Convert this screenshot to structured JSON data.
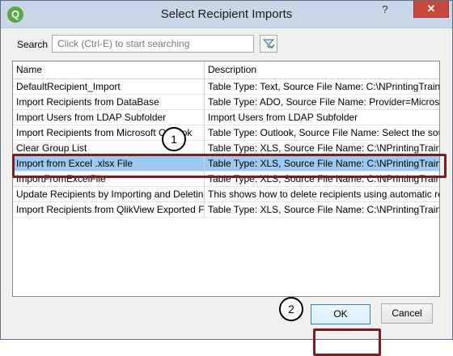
{
  "window": {
    "title": "Select Recipient Imports",
    "help_label": "?",
    "close_label": "✕"
  },
  "search": {
    "label": "Search",
    "placeholder": "Click (Ctrl-E) to start searching"
  },
  "grid": {
    "columns": [
      "Name",
      "Description"
    ],
    "rows": [
      {
        "name": "DefaultRecipient_Import",
        "description": "Table Type: Text, Source File Name: C:\\NPrintingTraini"
      },
      {
        "name": "Import Recipients from DataBase",
        "description": "Table Type: ADO, Source File Name: Provider=Microsc"
      },
      {
        "name": "Import Users from LDAP Subfolder",
        "description": "Import Users from LDAP Subfolder"
      },
      {
        "name": "Import Recipients from Microsoft Outlook",
        "description": "Table Type: Outlook, Source File Name: Select the sour"
      },
      {
        "name": "Clear Group List",
        "description": "Table Type: XLS, Source File Name: C:\\NPrintingTraini"
      },
      {
        "name": "Import from Excel .xlsx File",
        "description": "Table Type: XLS, Source File Name: C:\\NPrintingTraini"
      },
      {
        "name": "ImportFromExcelFile",
        "description": "Table Type: XLS, Source File Name: C:\\NPrintingTraini"
      },
      {
        "name": "Update Recipients by Importing and Deleting",
        "description": "This shows how to delete recipients using automatic re"
      },
      {
        "name": "Import Recipients from QlikView Exported Fi",
        "description": "Table Type: XLS, Source File Name: C:\\NPrintingTraini"
      }
    ],
    "selected_index": 5
  },
  "callouts": [
    "1",
    "2"
  ],
  "buttons": {
    "ok": "OK",
    "cancel": "Cancel"
  },
  "colors": {
    "selection": "#9ccaf0",
    "highlight_border": "#7a1e22",
    "close_button": "#c9483c",
    "app_icon": "#55a845"
  },
  "icons": {
    "app": "qlik-app-icon",
    "filter": "filter-icon"
  }
}
